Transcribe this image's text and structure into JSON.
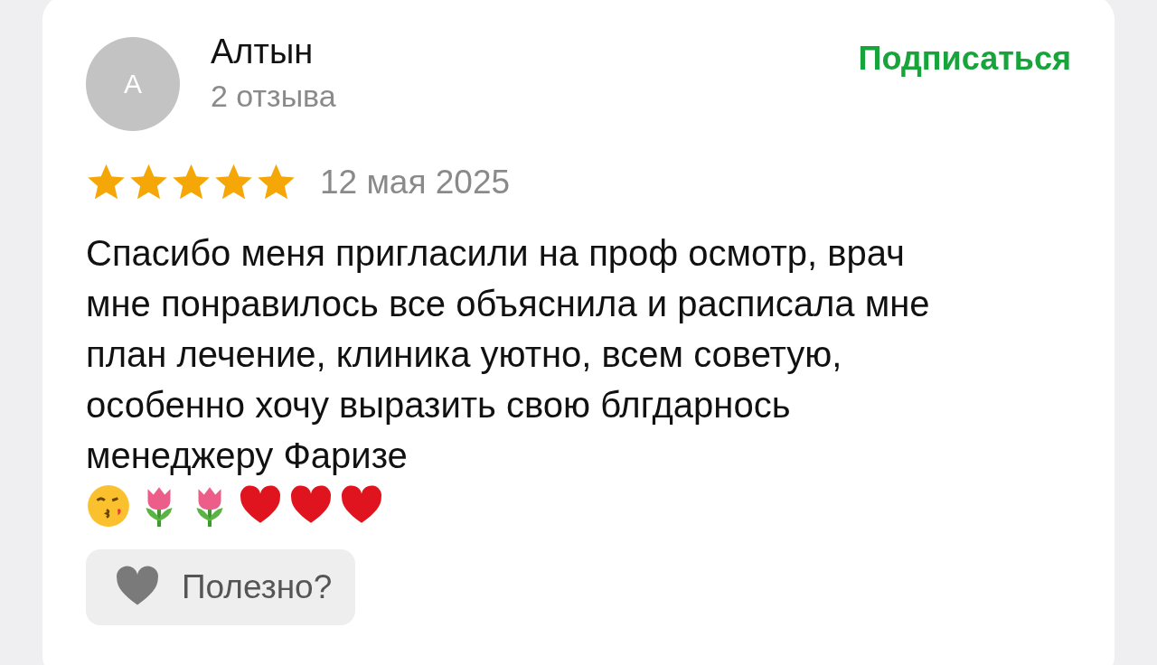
{
  "author": {
    "initial": "А",
    "name": "Алтын",
    "reviews_count": "2 отзыва"
  },
  "subscribe": {
    "label": "Подписаться"
  },
  "rating": {
    "stars": 5,
    "date": "12 мая 2025"
  },
  "review": {
    "text": "Спасибо меня пригласили на проф осмотр, врач мне понравилось все объяснила и расписала мне план лечение, клиника уютно, всем советую, особенно хочу выразить свою блгдарнось менеджеру Фаризе",
    "emojis": [
      {
        "kind": "kiss"
      },
      {
        "kind": "tulip"
      },
      {
        "kind": "tulip"
      },
      {
        "kind": "heart"
      },
      {
        "kind": "heart"
      },
      {
        "kind": "heart"
      }
    ]
  },
  "helpful_button": {
    "label": "Полезно?"
  }
}
